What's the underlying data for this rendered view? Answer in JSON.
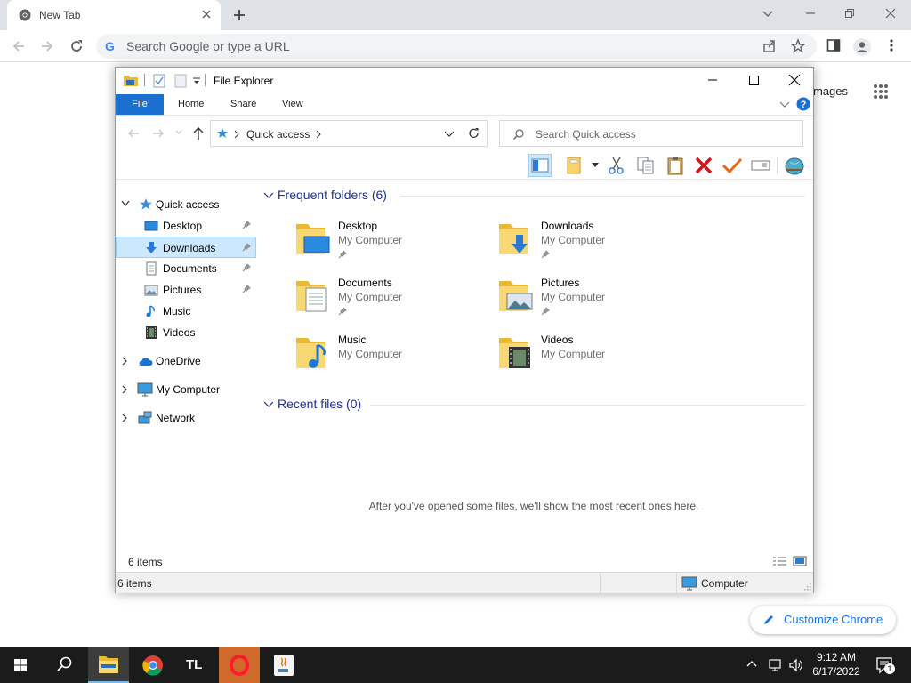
{
  "browser": {
    "tab_title": "New Tab",
    "omnibox_placeholder": "Search Google or type a URL",
    "omnibox_g": "G",
    "images_link": "mages",
    "customize_label": "Customize Chrome"
  },
  "explorer": {
    "window_title": "File Explorer",
    "ribbon_tabs": [
      "File",
      "Home",
      "Share",
      "View"
    ],
    "address_crumb": "Quick access",
    "search_placeholder": "Search Quick access",
    "nav": {
      "quick_access": "Quick access",
      "desktop": "Desktop",
      "downloads": "Downloads",
      "documents": "Documents",
      "pictures": "Pictures",
      "music": "Music",
      "videos": "Videos",
      "onedrive": "OneDrive",
      "my_computer": "My Computer",
      "network": "Network"
    },
    "frequent_header": "Frequent folders (6)",
    "recent_header": "Recent files (0)",
    "recent_message": "After you've opened some files, we'll show the most recent ones here.",
    "folders": [
      {
        "name": "Desktop",
        "location": "My Computer"
      },
      {
        "name": "Downloads",
        "location": "My Computer"
      },
      {
        "name": "Documents",
        "location": "My Computer"
      },
      {
        "name": "Pictures",
        "location": "My Computer"
      },
      {
        "name": "Music",
        "location": "My Computer"
      },
      {
        "name": "Videos",
        "location": "My Computer"
      }
    ],
    "item_count": "6 items",
    "status_items": "6 items",
    "status_location": "Computer"
  },
  "taskbar": {
    "app_tl_label": "TL",
    "time": "9:12 AM",
    "date": "6/17/2022",
    "notification_count": "1"
  },
  "colors": {
    "accent_blue": "#1a6fcf",
    "selection_bg": "#cce8ff",
    "section_header": "#1e3287",
    "taskbar_bg": "#1b1b1b"
  }
}
